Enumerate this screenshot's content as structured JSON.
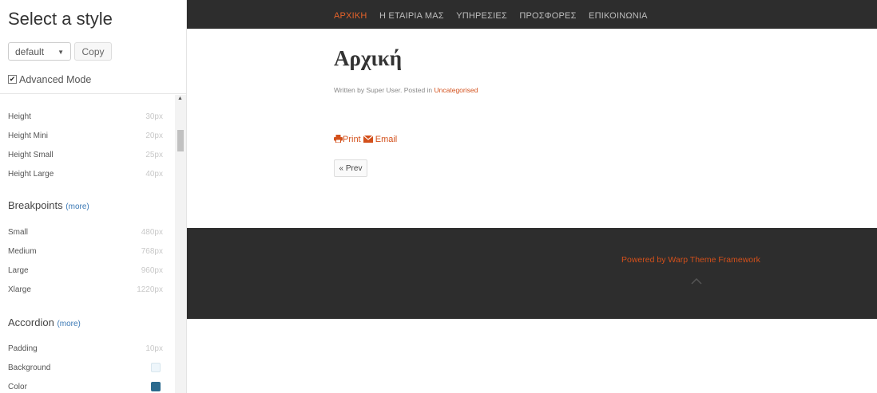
{
  "panel": {
    "title": "Select a style",
    "style_select": "default",
    "copy_label": "Copy",
    "advanced_mode_label": "Advanced Mode",
    "advanced_mode_checked": true,
    "height_vars": [
      {
        "name": "Height",
        "value": "30px"
      },
      {
        "name": "Height Mini",
        "value": "20px"
      },
      {
        "name": "Height Small",
        "value": "25px"
      },
      {
        "name": "Height Large",
        "value": "40px"
      }
    ],
    "breakpoints": {
      "title": "Breakpoints",
      "more": "(more)",
      "vars": [
        {
          "name": "Small",
          "value": "480px"
        },
        {
          "name": "Medium",
          "value": "768px"
        },
        {
          "name": "Large",
          "value": "960px"
        },
        {
          "name": "Xlarge",
          "value": "1220px"
        }
      ]
    },
    "accordion": {
      "title": "Accordion",
      "more": "(more)",
      "vars": [
        {
          "name": "Padding",
          "value": "10px"
        },
        {
          "name": "Background",
          "color": "#eef6fb"
        },
        {
          "name": "Color",
          "color": "#2b6a8e"
        }
      ]
    }
  },
  "site": {
    "nav": [
      "ΑΡΧΙΚΗ",
      "Η ΕΤΑΙΡΙΑ ΜΑΣ",
      "ΥΠΗΡΕΣΙΕΣ",
      "ΠΡΟΣΦΟΡΕΣ",
      "ΕΠΙΚΟΙΝΩΝΙΑ"
    ],
    "article": {
      "title": "Αρχική",
      "meta_prefix": "Written by Super User. Posted in ",
      "meta_category": "Uncategorised",
      "print_label": "Print",
      "email_label": "Email",
      "prev_label": "« Prev"
    },
    "footer": {
      "powered": "Powered by Warp Theme Framework"
    },
    "colors": {
      "accent": "#d3501b",
      "nav_active": "#e4622a",
      "dark_bar": "#2d2d2d"
    }
  }
}
